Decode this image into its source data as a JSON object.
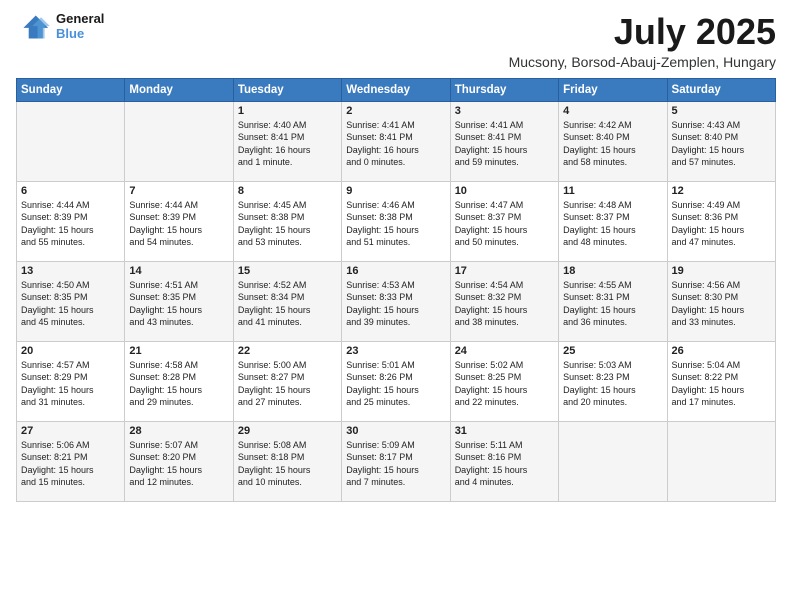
{
  "header": {
    "logo_general": "General",
    "logo_blue": "Blue",
    "month_title": "July 2025",
    "location": "Mucsony, Borsod-Abauj-Zemplen, Hungary"
  },
  "weekdays": [
    "Sunday",
    "Monday",
    "Tuesday",
    "Wednesday",
    "Thursday",
    "Friday",
    "Saturday"
  ],
  "weeks": [
    [
      {
        "day": "",
        "info": ""
      },
      {
        "day": "",
        "info": ""
      },
      {
        "day": "1",
        "info": "Sunrise: 4:40 AM\nSunset: 8:41 PM\nDaylight: 16 hours\nand 1 minute."
      },
      {
        "day": "2",
        "info": "Sunrise: 4:41 AM\nSunset: 8:41 PM\nDaylight: 16 hours\nand 0 minutes."
      },
      {
        "day": "3",
        "info": "Sunrise: 4:41 AM\nSunset: 8:41 PM\nDaylight: 15 hours\nand 59 minutes."
      },
      {
        "day": "4",
        "info": "Sunrise: 4:42 AM\nSunset: 8:40 PM\nDaylight: 15 hours\nand 58 minutes."
      },
      {
        "day": "5",
        "info": "Sunrise: 4:43 AM\nSunset: 8:40 PM\nDaylight: 15 hours\nand 57 minutes."
      }
    ],
    [
      {
        "day": "6",
        "info": "Sunrise: 4:44 AM\nSunset: 8:39 PM\nDaylight: 15 hours\nand 55 minutes."
      },
      {
        "day": "7",
        "info": "Sunrise: 4:44 AM\nSunset: 8:39 PM\nDaylight: 15 hours\nand 54 minutes."
      },
      {
        "day": "8",
        "info": "Sunrise: 4:45 AM\nSunset: 8:38 PM\nDaylight: 15 hours\nand 53 minutes."
      },
      {
        "day": "9",
        "info": "Sunrise: 4:46 AM\nSunset: 8:38 PM\nDaylight: 15 hours\nand 51 minutes."
      },
      {
        "day": "10",
        "info": "Sunrise: 4:47 AM\nSunset: 8:37 PM\nDaylight: 15 hours\nand 50 minutes."
      },
      {
        "day": "11",
        "info": "Sunrise: 4:48 AM\nSunset: 8:37 PM\nDaylight: 15 hours\nand 48 minutes."
      },
      {
        "day": "12",
        "info": "Sunrise: 4:49 AM\nSunset: 8:36 PM\nDaylight: 15 hours\nand 47 minutes."
      }
    ],
    [
      {
        "day": "13",
        "info": "Sunrise: 4:50 AM\nSunset: 8:35 PM\nDaylight: 15 hours\nand 45 minutes."
      },
      {
        "day": "14",
        "info": "Sunrise: 4:51 AM\nSunset: 8:35 PM\nDaylight: 15 hours\nand 43 minutes."
      },
      {
        "day": "15",
        "info": "Sunrise: 4:52 AM\nSunset: 8:34 PM\nDaylight: 15 hours\nand 41 minutes."
      },
      {
        "day": "16",
        "info": "Sunrise: 4:53 AM\nSunset: 8:33 PM\nDaylight: 15 hours\nand 39 minutes."
      },
      {
        "day": "17",
        "info": "Sunrise: 4:54 AM\nSunset: 8:32 PM\nDaylight: 15 hours\nand 38 minutes."
      },
      {
        "day": "18",
        "info": "Sunrise: 4:55 AM\nSunset: 8:31 PM\nDaylight: 15 hours\nand 36 minutes."
      },
      {
        "day": "19",
        "info": "Sunrise: 4:56 AM\nSunset: 8:30 PM\nDaylight: 15 hours\nand 33 minutes."
      }
    ],
    [
      {
        "day": "20",
        "info": "Sunrise: 4:57 AM\nSunset: 8:29 PM\nDaylight: 15 hours\nand 31 minutes."
      },
      {
        "day": "21",
        "info": "Sunrise: 4:58 AM\nSunset: 8:28 PM\nDaylight: 15 hours\nand 29 minutes."
      },
      {
        "day": "22",
        "info": "Sunrise: 5:00 AM\nSunset: 8:27 PM\nDaylight: 15 hours\nand 27 minutes."
      },
      {
        "day": "23",
        "info": "Sunrise: 5:01 AM\nSunset: 8:26 PM\nDaylight: 15 hours\nand 25 minutes."
      },
      {
        "day": "24",
        "info": "Sunrise: 5:02 AM\nSunset: 8:25 PM\nDaylight: 15 hours\nand 22 minutes."
      },
      {
        "day": "25",
        "info": "Sunrise: 5:03 AM\nSunset: 8:23 PM\nDaylight: 15 hours\nand 20 minutes."
      },
      {
        "day": "26",
        "info": "Sunrise: 5:04 AM\nSunset: 8:22 PM\nDaylight: 15 hours\nand 17 minutes."
      }
    ],
    [
      {
        "day": "27",
        "info": "Sunrise: 5:06 AM\nSunset: 8:21 PM\nDaylight: 15 hours\nand 15 minutes."
      },
      {
        "day": "28",
        "info": "Sunrise: 5:07 AM\nSunset: 8:20 PM\nDaylight: 15 hours\nand 12 minutes."
      },
      {
        "day": "29",
        "info": "Sunrise: 5:08 AM\nSunset: 8:18 PM\nDaylight: 15 hours\nand 10 minutes."
      },
      {
        "day": "30",
        "info": "Sunrise: 5:09 AM\nSunset: 8:17 PM\nDaylight: 15 hours\nand 7 minutes."
      },
      {
        "day": "31",
        "info": "Sunrise: 5:11 AM\nSunset: 8:16 PM\nDaylight: 15 hours\nand 4 minutes."
      },
      {
        "day": "",
        "info": ""
      },
      {
        "day": "",
        "info": ""
      }
    ]
  ]
}
